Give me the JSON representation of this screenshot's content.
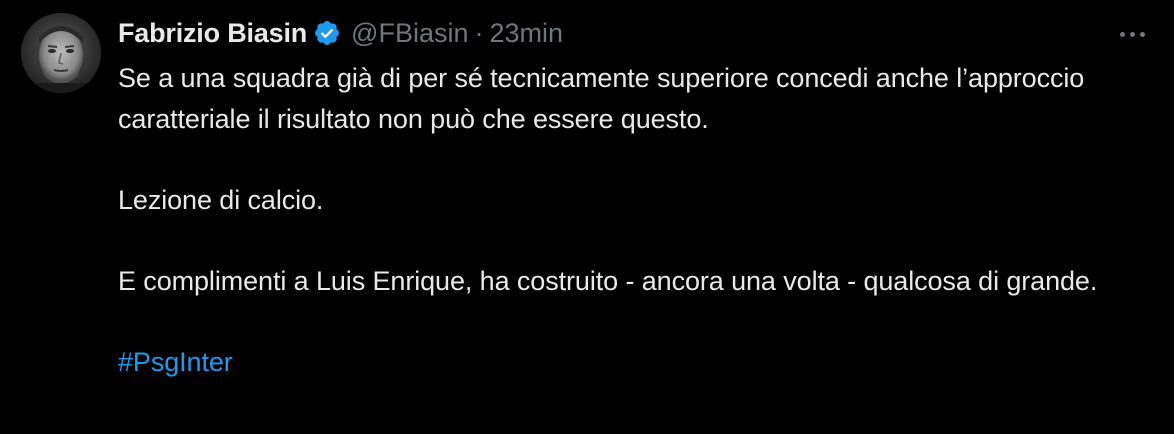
{
  "tweet": {
    "display_name": "Fabrizio Biasin",
    "handle": "@FBiasin",
    "separator": "·",
    "time": "23min",
    "paragraphs": [
      "Se a una squadra già di per sé tecnicamente superiore concedi anche l’approccio caratteriale il risultato non può che essere questo.",
      "Lezione di calcio.",
      "E complimenti a Luis Enrique, ha costruito - ancora una volta - qualcosa di grande."
    ],
    "hashtag": "#PsgInter"
  },
  "icons": {
    "verified": "verified-badge-icon",
    "more": "more-options-icon"
  },
  "colors": {
    "background": "#000000",
    "text": "#e7e9ea",
    "secondary": "#71767b",
    "accent": "#1d9bf0"
  }
}
